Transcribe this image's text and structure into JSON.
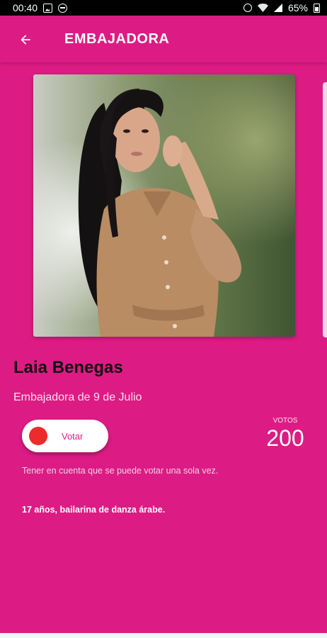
{
  "status_bar": {
    "time": "00:40",
    "battery": "65%",
    "icons": [
      "image-icon",
      "do-not-disturb-icon",
      "alarm-icon",
      "wifi-icon",
      "signal-icon",
      "battery-icon"
    ]
  },
  "app_bar": {
    "title": "EMBAJADORA",
    "back_icon": "arrow-left-icon"
  },
  "profile": {
    "name": "Laia Benegas",
    "subtitle": "Embajadora de 9 de Julio",
    "vote_label": "Votar",
    "votes_label": "VOTOS",
    "votes_count": "200",
    "note": "Tener en cuenta que se puede votar una sola vez.",
    "bio": "17 años, bailarina de danza árabe."
  },
  "colors": {
    "primary": "#dc1c84",
    "vote_dot": "#ee2b2b",
    "name_text": "#111111"
  }
}
